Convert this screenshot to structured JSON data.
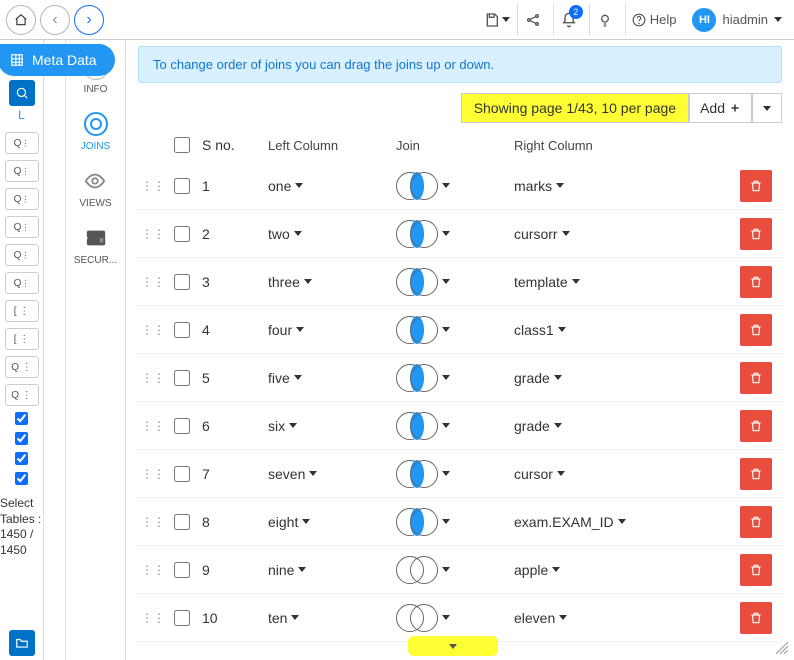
{
  "topbar": {
    "notif_count": "2",
    "help_label": "Help",
    "user_initials": "HI",
    "user_name": "hiadmin"
  },
  "meta_pill": {
    "label": "Meta Data"
  },
  "left_strip": {
    "label_top": "L",
    "footer_text": "Select Tables : 1450 / 1450"
  },
  "sidebar": {
    "items": [
      {
        "label": "INFO"
      },
      {
        "label": "JOINS"
      },
      {
        "label": "VIEWS"
      },
      {
        "label": "SECUR..."
      }
    ]
  },
  "banner": {
    "text": "To change order of joins you can drag the joins up or down."
  },
  "pager": {
    "info": "Showing page 1/43, 10 per page",
    "add": "Add"
  },
  "columns": {
    "sno": "S no.",
    "left": "Left Column",
    "join": "Join",
    "right": "Right Column"
  },
  "rows": [
    {
      "sno": "1",
      "left": "one",
      "right": "marks",
      "inner": true
    },
    {
      "sno": "2",
      "left": "two",
      "right": "cursorr",
      "inner": true
    },
    {
      "sno": "3",
      "left": "three",
      "right": "template",
      "inner": true
    },
    {
      "sno": "4",
      "left": "four",
      "right": "class1",
      "inner": true
    },
    {
      "sno": "5",
      "left": "five",
      "right": "grade",
      "inner": true
    },
    {
      "sno": "6",
      "left": "six",
      "right": "grade",
      "inner": true
    },
    {
      "sno": "7",
      "left": "seven",
      "right": "cursor",
      "inner": true
    },
    {
      "sno": "8",
      "left": "eight",
      "right": "exam.EXAM_ID",
      "inner": true
    },
    {
      "sno": "9",
      "left": "nine",
      "right": "apple",
      "inner": false
    },
    {
      "sno": "10",
      "left": "ten",
      "right": "eleven",
      "inner": false
    }
  ]
}
